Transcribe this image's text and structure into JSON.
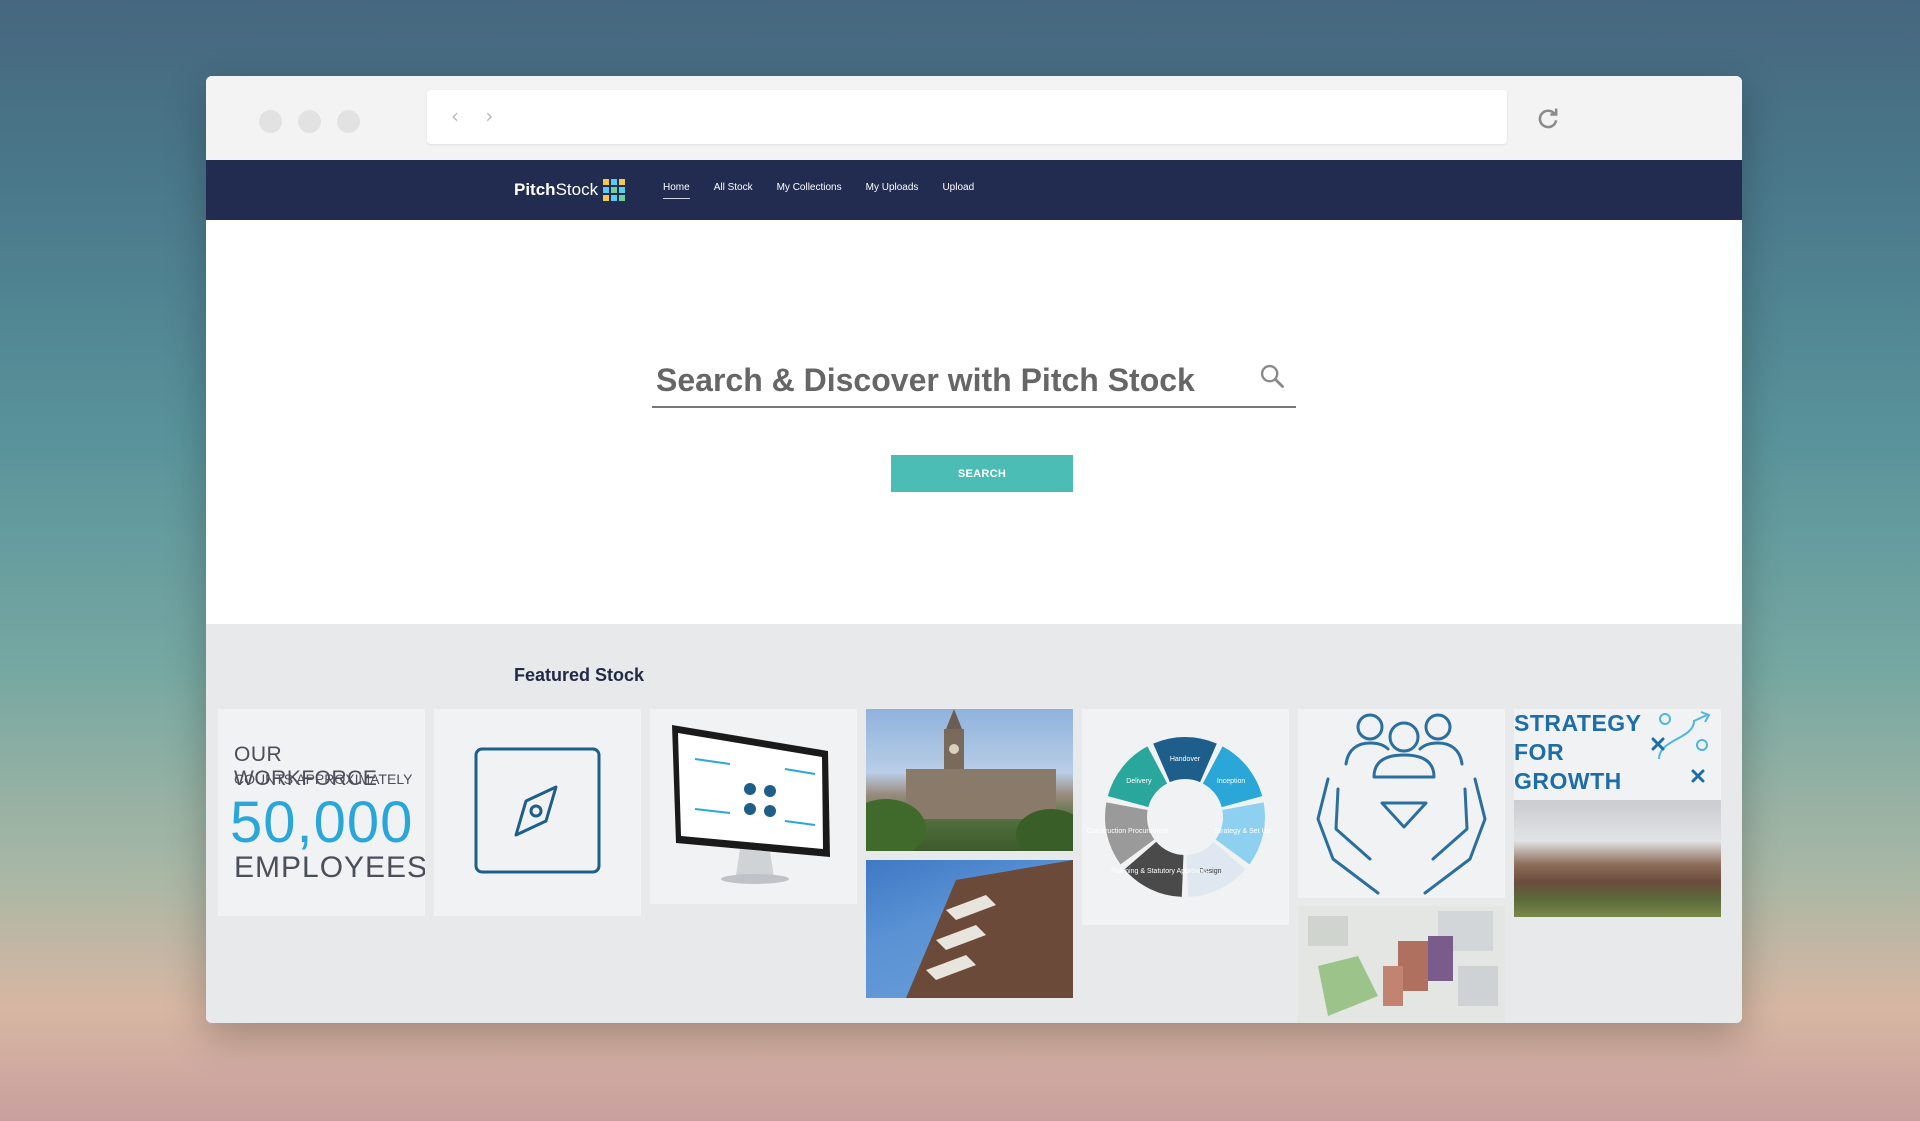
{
  "browser": {
    "nav_arrows": "‹ ›"
  },
  "brand": {
    "name_part1": "Pitch",
    "name_part2": "Stock",
    "grid_colors": [
      "#f2c94c",
      "#56ccf2",
      "#f2c94c",
      "#56ccf2",
      "#6fcf97",
      "#56ccf2",
      "#f2c94c",
      "#56ccf2",
      "#6fcf97"
    ]
  },
  "nav": {
    "items": [
      {
        "label": "Home",
        "active": true
      },
      {
        "label": "All Stock",
        "active": false
      },
      {
        "label": "My Collections",
        "active": false
      },
      {
        "label": "My Uploads",
        "active": false
      },
      {
        "label": "Upload",
        "active": false
      }
    ]
  },
  "search": {
    "placeholder": "Search & Discover with Pitch Stock",
    "button_label": "SEARCH"
  },
  "featured": {
    "title": "Featured Stock",
    "workforce": {
      "line1": "OUR WORKFORCE",
      "line2": "COUNTS APPROXIMATELY",
      "number": "50,000",
      "line4": "EMPLOYEES"
    },
    "cycle": {
      "segments": [
        "Handover",
        "Inception",
        "Strategy & Set Up",
        "Design",
        "Planning & Statutory Approvals",
        "Construction Procurement",
        "Delivery"
      ]
    },
    "strategy": {
      "line1": "STRATEGY",
      "line2": "FOR",
      "line3": "GROWTH"
    }
  },
  "colors": {
    "nav_bg": "#222c50",
    "accent": "#4bbdb5",
    "featured_bg": "#e8e9eb"
  }
}
